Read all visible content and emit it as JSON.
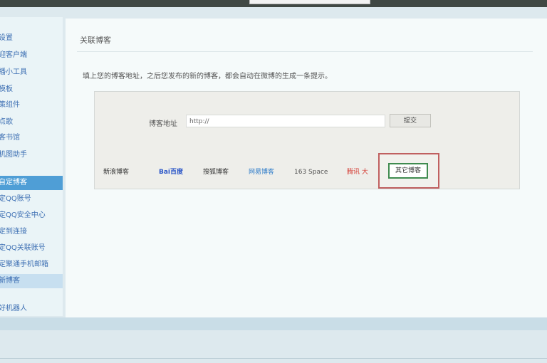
{
  "sidebar": {
    "items": [
      {
        "label": "设置"
      },
      {
        "label": "迎客户端"
      },
      {
        "label": "播小工具"
      },
      {
        "label": "模板"
      },
      {
        "label": "策组件"
      },
      {
        "label": "点歌"
      },
      {
        "label": "客书馆"
      },
      {
        "label": "机图助手"
      },
      {
        "label": "自定博客"
      },
      {
        "label": "定QQ账号"
      },
      {
        "label": "定QQ安全中心"
      },
      {
        "label": "定到连接"
      },
      {
        "label": "定QQ关联账号"
      },
      {
        "label": "定聚通手机邮箱"
      },
      {
        "label": "新博客"
      },
      {
        "label": "好机器人"
      }
    ]
  },
  "main": {
    "title": "关联博客",
    "description": "填上您的博客地址，之后您发布的新的博客，都会自动在微博的生成一条提示。",
    "address_label": "博客地址",
    "address_value": "http://",
    "submit_label": "提交",
    "providers": [
      "新浪博客",
      "Bai百度",
      "搜狐博客",
      "网易博客",
      "163 Space",
      "腾讯 大",
      "其它博客"
    ]
  }
}
